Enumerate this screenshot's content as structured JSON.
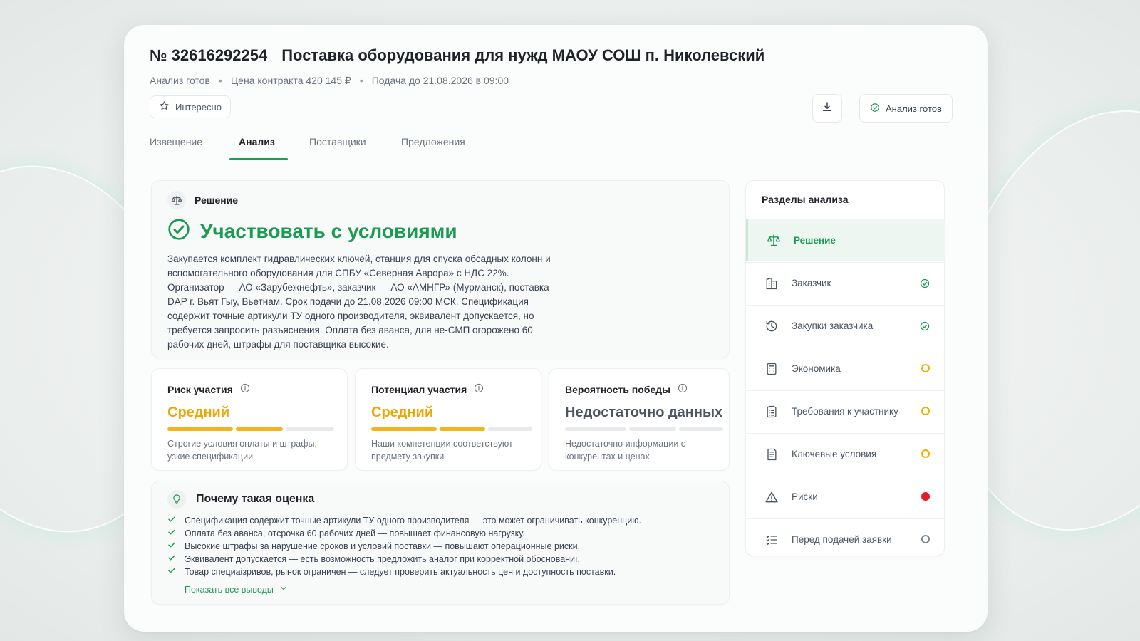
{
  "header": {
    "number": "№ 32616292254",
    "title": "Поставка оборудования для нужд МАОУ СОШ п. Николевский",
    "meta": [
      "Анализ готов",
      "Цена контракта 420 145 ₽",
      "Подача до 21.08.2026 в 09:00"
    ],
    "interest_label": "Интересно",
    "status_label": "Анализ готов",
    "icons": {
      "interest": "star-icon",
      "download": "download-icon",
      "status": "check-circle-icon"
    }
  },
  "tabs": [
    {
      "label": "Извещение",
      "active": false
    },
    {
      "label": "Анализ",
      "active": true
    },
    {
      "label": "Поставщики",
      "active": false
    },
    {
      "label": "Предложения",
      "active": false
    }
  ],
  "decision": {
    "heading": "Решение",
    "verdict": "Участвовать с условиями",
    "summary": "Закупается комплект гидравлических ключей, станция для спуска обсадных колонн и вспомогательного оборудования для СПБУ «Северная Аврора» с НДС 22%. Организатор — АО «Зарубежнефть», заказчик — АО «АМНГР» (Мурманск), поставка DAP г. Вьят Гыу, Вьетнам. Срок подачи до 21.08.2026 09:00 МСК. Спецификация содержит точные артикули ТУ одного производителя, эквивалент допускается, но требуется запросить разъяснения. Оплата без аванса, для не-СМП огорожено 60 рабочих дней, штрафы для поставщика высокие.",
    "accent_color": "#1b9a52"
  },
  "metrics": [
    {
      "title": "Риск участия",
      "value": "Средний",
      "level": 2,
      "of": 3,
      "description": "Строгие условия оплаты и штрафы, узкие спецификации"
    },
    {
      "title": "Потенциал участия",
      "value": "Средний",
      "level": 2,
      "of": 3,
      "description": "Наши компетенции соответствуют предмету закупки"
    },
    {
      "title": "Вероятность победы",
      "value": "Недостаточно данных",
      "level": 0,
      "of": 3,
      "description": "Недостаточно информации о конкурентах и ценах"
    }
  ],
  "why": {
    "heading": "Почему такая оценка",
    "items": [
      "Спецификация содержит точные артикули ТУ одного производителя — это может ограничивать конкуренцию.",
      "Оплата без аванса, отсрочка 60 рабочих дней — повышает финансовую нагрузку.",
      "Высокие штрафы за нарушение сроков и условий поставки — повышают операционные риски.",
      "Эквивалент допускается — есть возможность предложить аналог при корректной обоснованиı.",
      "Товар специаізривов, рынок ограничен — следует проверить актуальность цен и доступность поставки."
    ],
    "more_label": "Показать все выводы"
  },
  "sections": {
    "heading": "Разделы анализа",
    "items": [
      {
        "label": "Решение",
        "icon": "scales-icon",
        "status": "active"
      },
      {
        "label": "Заказчик",
        "icon": "building-icon",
        "status": "done"
      },
      {
        "label": "Закупки заказчика",
        "icon": "history-icon",
        "status": "done"
      },
      {
        "label": "Экономика",
        "icon": "calculator-icon",
        "status": "pending"
      },
      {
        "label": "Требования к участнику",
        "icon": "clipboard-icon",
        "status": "pending"
      },
      {
        "label": "Ключевые условия",
        "icon": "document-icon",
        "status": "pending"
      },
      {
        "label": "Риски",
        "icon": "warning-icon",
        "status": "alert"
      },
      {
        "label": "Перед подачей заявки",
        "icon": "checklist-icon",
        "status": "empty"
      }
    ]
  },
  "colors": {
    "green": "#1b9a52",
    "orange": "#f0a500",
    "red": "#e11d2a"
  }
}
